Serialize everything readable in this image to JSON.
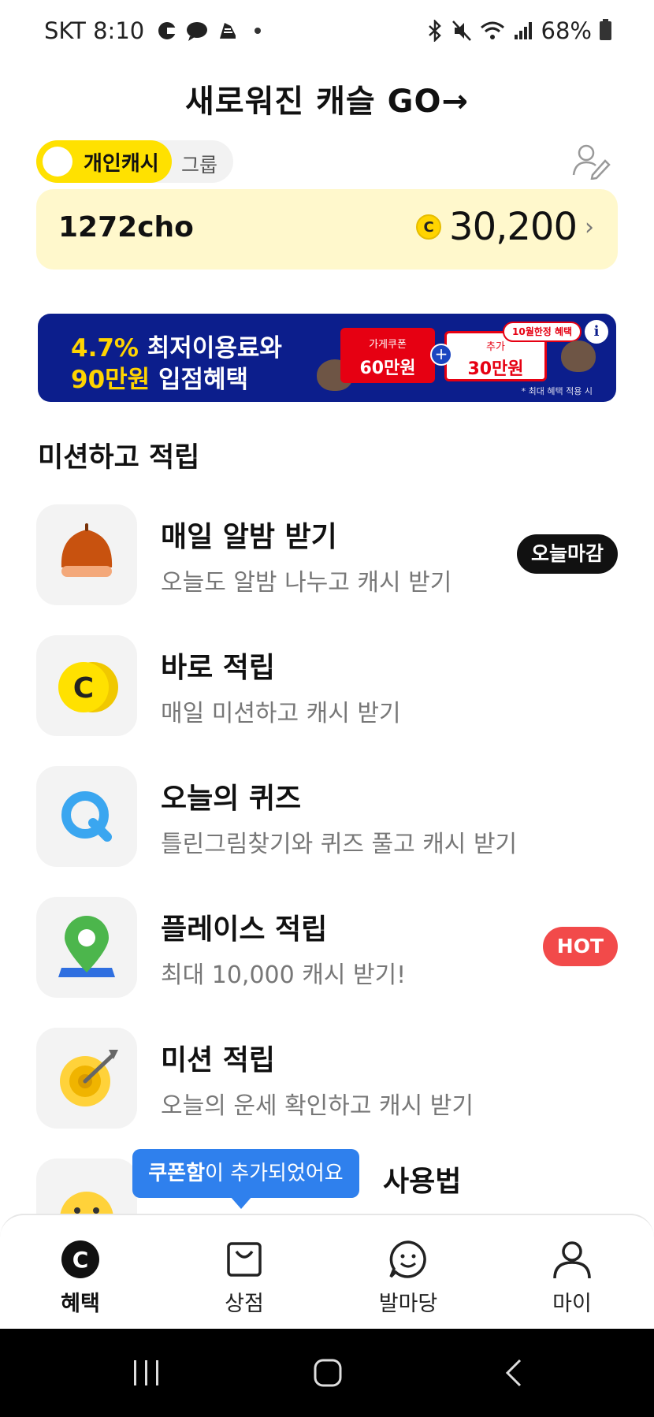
{
  "status_bar": {
    "carrier_time": "SKT 8:10",
    "battery": "68%"
  },
  "header": {
    "title": "새로워진 캐슬   GO→"
  },
  "toggle": {
    "active_label": "개인캐시",
    "inactive_label": "그룹"
  },
  "cash_card": {
    "username": "1272cho",
    "coin_symbol": "C",
    "amount": "30,200",
    "chevron": "›"
  },
  "banner": {
    "line1_highlight": "4.7%",
    "line1_rest": " 최저이용료와",
    "line2_highlight": "90만원",
    "line2_rest": " 입점혜택",
    "coupon1_small": "가게쿠폰",
    "coupon1_big": "60만원",
    "plus": "+",
    "coupon2_small": "추가",
    "coupon2_big": "30만원",
    "tag": "10월한정 혜택",
    "info": "i",
    "note": "* 최대 혜택 적용 시"
  },
  "section": {
    "title": "미션하고 적립"
  },
  "list": [
    {
      "title": "매일 알밤 받기",
      "subtitle": "오늘도 알밤 나누고 캐시 받기",
      "badge": "오늘마감",
      "icon": "chestnut-icon"
    },
    {
      "title": "바로 적립",
      "subtitle": "매일 미션하고 캐시 받기",
      "badge": "",
      "icon": "coin-icon"
    },
    {
      "title": "오늘의 퀴즈",
      "subtitle": "틀린그림찾기와 퀴즈 풀고 캐시 받기",
      "badge": "",
      "icon": "quiz-icon"
    },
    {
      "title": "플레이스 적립",
      "subtitle": "최대 10,000 캐시 받기!",
      "badge": "HOT",
      "icon": "map-pin-icon"
    },
    {
      "title": "미션 적립",
      "subtitle": "오늘의 운세 확인하고 캐시 받기",
      "badge": "",
      "icon": "target-icon"
    },
    {
      "title": "사용법",
      "subtitle": "",
      "badge": "",
      "icon": "emoji-icon"
    }
  ],
  "tooltip": {
    "bold": "쿠폰함",
    "rest": "이 추가되었어요"
  },
  "bottom_nav": {
    "items": [
      {
        "label": "혜택",
        "icon": "cash-c-icon",
        "active": true
      },
      {
        "label": "상점",
        "icon": "shopping-bag-icon",
        "active": false
      },
      {
        "label": "발마당",
        "icon": "chat-smile-icon",
        "active": false
      },
      {
        "label": "마이",
        "icon": "person-icon",
        "active": false
      }
    ]
  },
  "colors": {
    "brand_yellow": "#ffe100",
    "card_bg": "#fff8cc",
    "banner_bg": "#0c1e8c",
    "hot_red": "#f24a4a",
    "tooltip_blue": "#2f80ed"
  }
}
